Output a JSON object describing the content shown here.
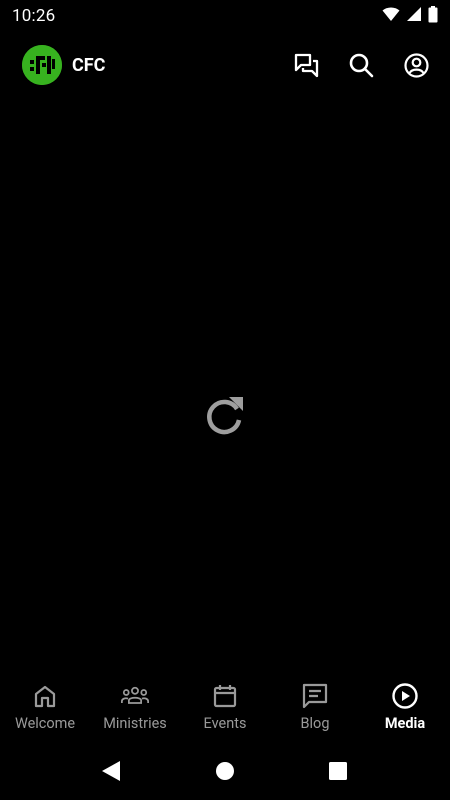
{
  "status_bar": {
    "time": "10:26",
    "icons": [
      "wifi-icon",
      "cellular-signal-icon",
      "battery-icon"
    ]
  },
  "app_bar": {
    "logo_text": "CFC",
    "logo_color": "#37b21f",
    "brand": "CFC",
    "actions": [
      "chat-icon",
      "search-icon",
      "account-icon"
    ]
  },
  "content": {
    "state": "reload",
    "icon": "refresh-icon"
  },
  "bottom_nav": {
    "active_color": "#ffffff",
    "inactive_color": "#9a9a9a",
    "items": [
      {
        "label": "Welcome",
        "icon": "home-icon"
      },
      {
        "label": "Ministries",
        "icon": "groups-icon"
      },
      {
        "label": "Events",
        "icon": "calendar-icon"
      },
      {
        "label": "Blog",
        "icon": "blog-icon"
      },
      {
        "label": "Media",
        "icon": "play-circle-icon",
        "active": true
      }
    ]
  },
  "system_nav": [
    "back-icon",
    "home-button-icon",
    "recents-icon"
  ]
}
